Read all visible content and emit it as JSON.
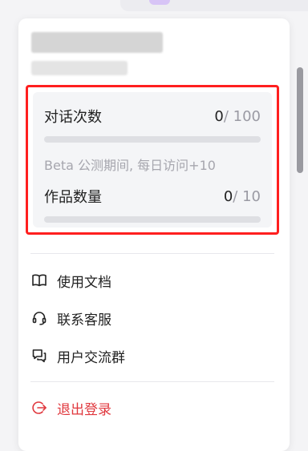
{
  "usage": {
    "conversations": {
      "label": "对话次数",
      "used": "0",
      "total": "/ 100",
      "fraction": 0
    },
    "note": "Beta 公测期间, 每日访问+10",
    "works": {
      "label": "作品数量",
      "used": "0",
      "total": "/ 10",
      "fraction": 0
    }
  },
  "menu": {
    "docs": {
      "label": "使用文档",
      "icon": "book-open-icon"
    },
    "support": {
      "label": "联系客服",
      "icon": "headset-icon"
    },
    "group": {
      "label": "用户交流群",
      "icon": "chat-bubbles-icon"
    },
    "logout": {
      "label": "退出登录",
      "icon": "logout-icon"
    }
  },
  "colors": {
    "highlight": "#ff1f1f",
    "logout": "#e0383e",
    "bar_track": "#dedfe3",
    "avatar": "#d7c4f6"
  }
}
